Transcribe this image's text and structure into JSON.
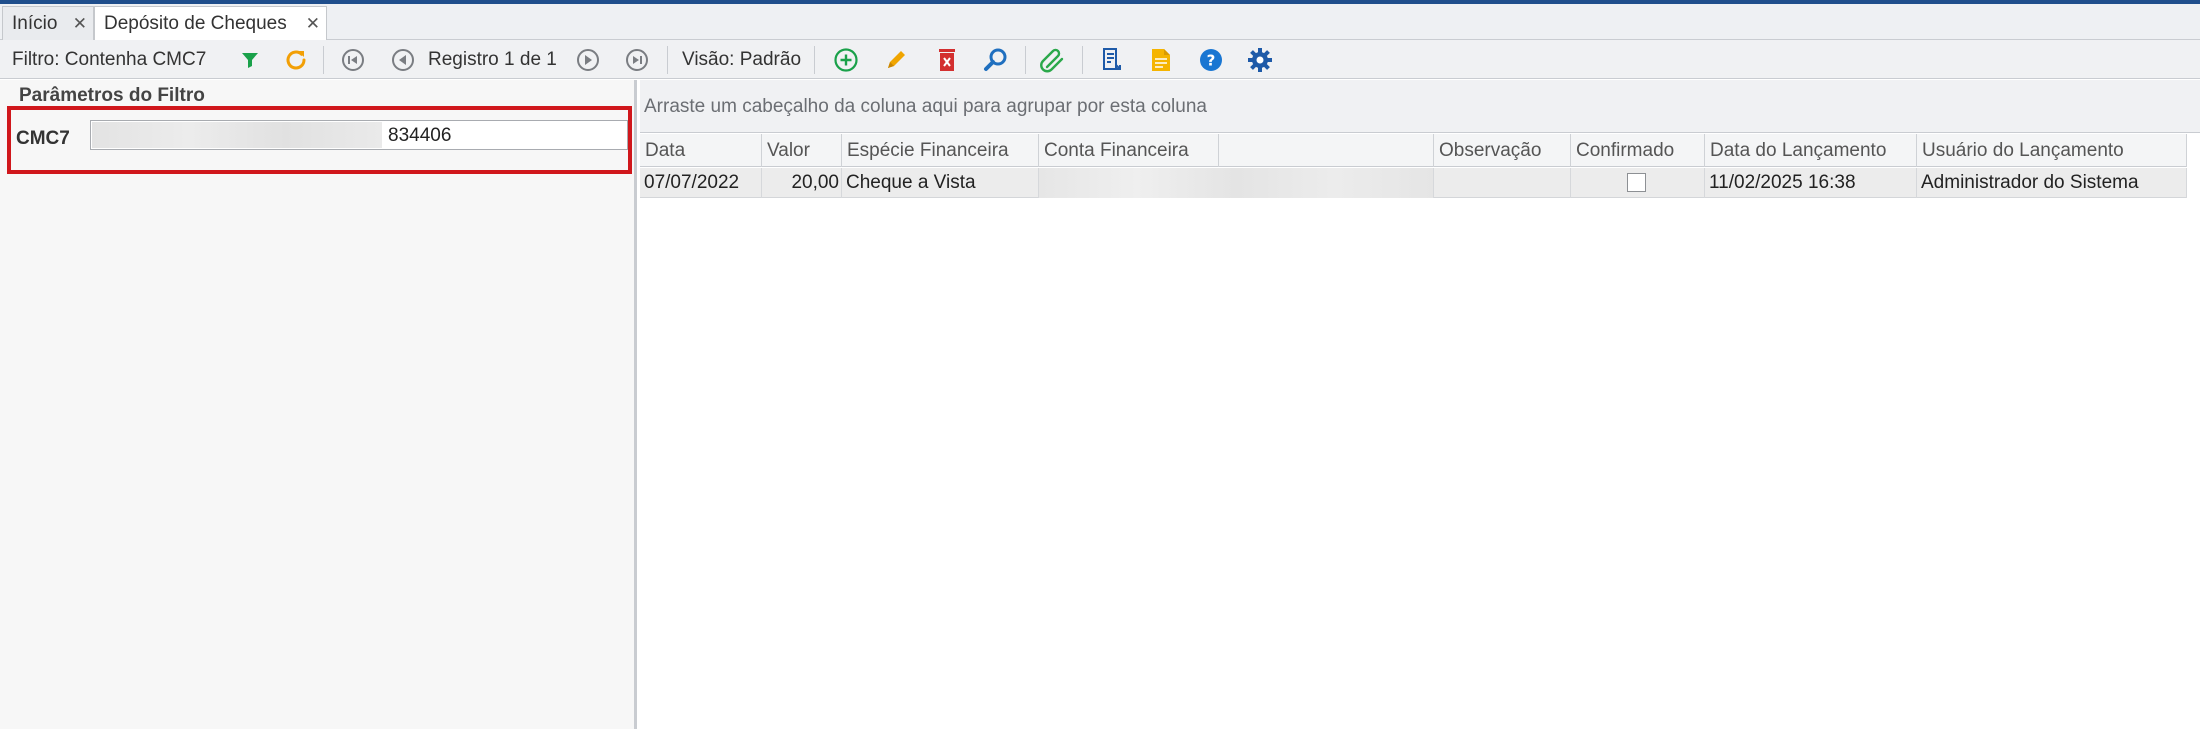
{
  "tabs": [
    {
      "label": "Início",
      "active": false
    },
    {
      "label": "Depósito de Cheques",
      "active": true
    }
  ],
  "toolbar": {
    "filter_label": "Filtro: Contenha CMC7",
    "record_label": "Registro 1 de 1",
    "view_label": "Visão: Padrão",
    "icons": [
      "filter-icon",
      "refresh-icon",
      "first-record-icon",
      "previous-record-icon",
      "next-record-icon",
      "last-record-icon",
      "add-icon",
      "edit-icon",
      "delete-icon",
      "search-icon",
      "attach-icon",
      "report-icon",
      "document-icon",
      "help-icon",
      "settings-icon"
    ]
  },
  "filter_panel": {
    "title": "Parâmetros do Filtro",
    "cmc7_label": "CMC7",
    "cmc7_value": "834406"
  },
  "grid": {
    "group_hint": "Arraste um cabeçalho da coluna aqui para agrupar por esta coluna",
    "columns": [
      "Data",
      "Valor",
      "Espécie Financeira",
      "Conta Financeira",
      "",
      "Observação",
      "Confirmado",
      "Data do Lançamento",
      "Usuário do Lançamento"
    ],
    "rows": [
      {
        "data": "07/07/2022",
        "valor": "20,00",
        "especie": "Cheque a Vista",
        "conta": "",
        "observacao": "",
        "confirmado": false,
        "data_lancamento": "11/02/2025 16:38",
        "usuario": "Administrador do Sistema"
      }
    ]
  },
  "colors": {
    "accent_bar": "#1f4e8c",
    "highlight_border": "#d0171c",
    "filter_green": "#1aa14a",
    "refresh_orange": "#f29f05",
    "add_green": "#1aa14a",
    "edit_orange": "#f0a500",
    "delete_red": "#d32f2f",
    "search_blue": "#1f6fbf",
    "help_blue": "#1976d2",
    "settings_blue": "#1e5aa8"
  }
}
